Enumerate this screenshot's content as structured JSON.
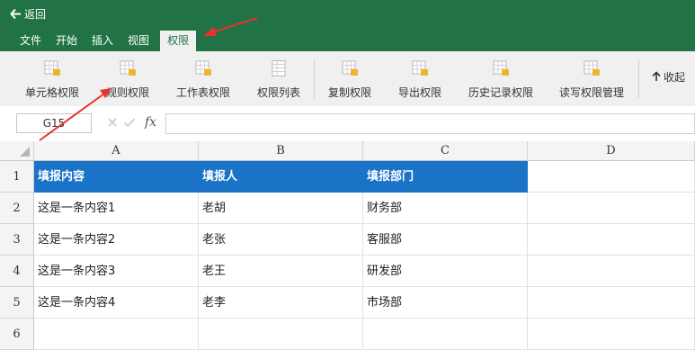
{
  "topbar": {
    "back_label": "返回",
    "tabs": [
      {
        "label": "文件"
      },
      {
        "label": "开始"
      },
      {
        "label": "插入"
      },
      {
        "label": "视图"
      },
      {
        "label": "权限",
        "active": true
      }
    ]
  },
  "ribbon": {
    "buttons": [
      {
        "label": "单元格权限"
      },
      {
        "label": "规则权限"
      },
      {
        "label": "工作表权限"
      },
      {
        "label": "权限列表"
      },
      {
        "label": "复制权限"
      },
      {
        "label": "导出权限"
      },
      {
        "label": "历史记录权限"
      },
      {
        "label": "读写权限管理"
      }
    ],
    "collapse_label": "收起"
  },
  "formula_bar": {
    "cell_ref": "G15",
    "fx_label": "fx",
    "formula_value": ""
  },
  "sheet": {
    "columns": [
      "A",
      "B",
      "C",
      "D"
    ],
    "rows": [
      "1",
      "2",
      "3",
      "4",
      "5",
      "6"
    ],
    "cells": [
      [
        "填报内容",
        "填报人",
        "填报部门",
        ""
      ],
      [
        "这是一条内容1",
        "老胡",
        "财务部",
        ""
      ],
      [
        "这是一条内容2",
        "老张",
        "客服部",
        ""
      ],
      [
        "这是一条内容3",
        "老王",
        "研发部",
        ""
      ],
      [
        "这是一条内容4",
        "老李",
        "市场部",
        ""
      ],
      [
        "",
        "",
        "",
        ""
      ]
    ]
  },
  "colors": {
    "brand_green": "#217346",
    "header_blue": "#1a73c7",
    "annotation_red": "#e8322d"
  }
}
